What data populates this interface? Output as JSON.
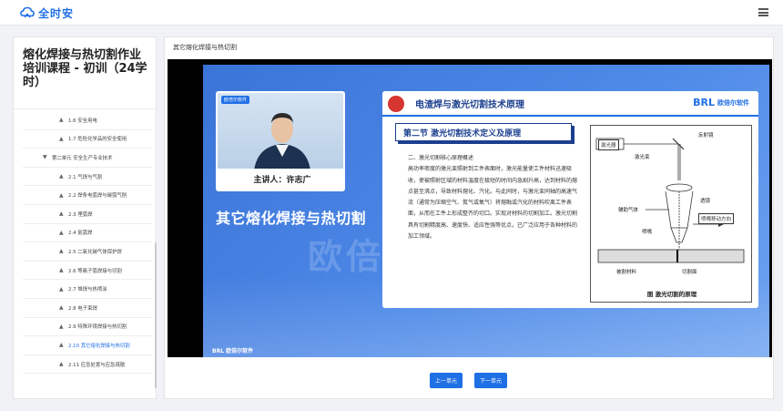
{
  "app": {
    "logo_text": "全时安",
    "brand_color": "#1f6fe5"
  },
  "sidebar": {
    "course_title": "熔化焊接与热切割作业培训课程 - 初训（24学时）",
    "items": [
      {
        "label": "1.6 安全用电",
        "level": 2,
        "caret": "▲"
      },
      {
        "label": "1.7 危险化学品的安全使用",
        "level": 2,
        "caret": "▲"
      },
      {
        "label": "第二单元 安全生产专业技术",
        "level": 1,
        "caret": "▼"
      },
      {
        "label": "2.1 气焊与气割",
        "level": 2,
        "caret": "▲"
      },
      {
        "label": "2.2 焊条电弧焊与碳弧气刨",
        "level": 2,
        "caret": "▲"
      },
      {
        "label": "2.3 埋弧焊",
        "level": 2,
        "caret": "▲"
      },
      {
        "label": "2.4 氩弧焊",
        "level": 2,
        "caret": "▲"
      },
      {
        "label": "2.5 二氧化碳气体保护焊",
        "level": 2,
        "caret": "▲"
      },
      {
        "label": "2.6 等离子弧焊接与切割",
        "level": 2,
        "caret": "▲"
      },
      {
        "label": "2.7 堆焊与热喷涂",
        "level": 2,
        "caret": "▲"
      },
      {
        "label": "2.8 电子束焊",
        "level": 2,
        "caret": "▲"
      },
      {
        "label": "2.9 特殊环境焊接与热切割",
        "level": 2,
        "caret": "▲"
      },
      {
        "label": "2.10 其它熔化焊接与热切割",
        "level": 2,
        "caret": "▲"
      },
      {
        "label": "2.11 应急处置与应急疏散",
        "level": 2,
        "caret": "▲"
      }
    ]
  },
  "main": {
    "title": "其它熔化焊接与热切割",
    "slide": {
      "video_brand": "欧倍尔软件",
      "speaker": "主讲人：许志广",
      "heading": "其它熔化焊接与热切割",
      "watermark": "欧倍",
      "panel_title": "电渣焊与激光切割技术原理",
      "panel_brand": "BRL",
      "panel_brand_sub": "欧倍尔软件",
      "section": "第二节  激光切割技术定义及原理",
      "body_heading": "二、激光切割核心原理概述",
      "body": "高功率密度的激光束照射到工件表面时，激光能量使工件材料迅速吸收，使被照射区域的材料温度在极短的时间内急剧升高，达到材料的熔点甚至沸点，导致材料熔化、汽化。与此同时，与激光束同轴的高速气流（通常为压缩空气、氮气或氧气）将熔融或汽化的材料吹离工件表面，从而在工件上形成整齐的切口。实现对材料的切割加工。激光切割具有切割精度高、速度快、适应性强等优点，已广泛应用于各种材料的加工领域。",
      "fig_labels": {
        "reflector": "反射镜",
        "laser": "激光器",
        "beam": "激光束",
        "aux_gas": "辅助气体",
        "lens": "透镜",
        "nozzle": "喷嘴",
        "nozzle_move": "喷嘴移动方向",
        "workpiece": "被割材料",
        "kerf": "切割面"
      },
      "fig_caption": "图   激光切割的原理",
      "footer": "BRL 欧倍尔软件"
    }
  },
  "buttons": {
    "prev": "上一单元",
    "next": "下一单元"
  }
}
